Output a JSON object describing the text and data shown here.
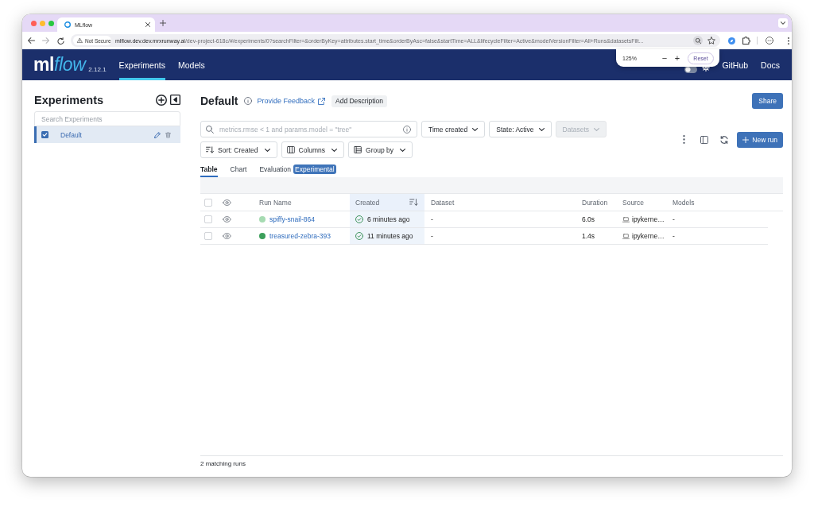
{
  "browser": {
    "tabs": [
      {
        "title": "MLflow",
        "selected": true
      }
    ],
    "security": "Not Secure",
    "url": "**mlflow.dev.dev.mrxrunway.ai**/dev-project-618c/#/experiments/0?searchFilter=&orderByKey=attributes.start_time&orderByAsc=false&startTime=ALL&lifecycleFilter=Active&modelVersionFilter=All+Runs&datasetsFilt..."
  },
  "zoom_popup": {
    "level": "125%",
    "zoom_out": "−",
    "zoom_in": "+",
    "reset": "Reset"
  },
  "header": {
    "logo": {
      "text": "ml",
      "accent": "flow"
    },
    "version": "2.12.1",
    "nav": [
      {
        "label": "Experiments",
        "selected": true
      },
      {
        "label": "Models",
        "selected": false
      }
    ],
    "links": [
      "GitHub",
      "Docs"
    ]
  },
  "sidebar": {
    "title": "Experiments",
    "search": {
      "placeholder": "Search Experiments"
    },
    "experiments": [
      {
        "name": "Default",
        "checked": true,
        "selected": true
      }
    ]
  },
  "main": {
    "title": "Default",
    "feedback_link": "Provide Feedback",
    "add_description": "Add Description",
    "share": "Share",
    "search": {
      "placeholder": "metrics.rmse < 1 and params.model = \"tree\""
    },
    "filters": [
      {
        "label": "Time created",
        "disabled": false
      },
      {
        "label": "State: Active",
        "disabled": false
      },
      {
        "label": "Datasets",
        "disabled": true
      }
    ],
    "new_run": "New run",
    "toolbar": [
      {
        "kind": "sort",
        "label": "Sort: Created"
      },
      {
        "kind": "columns",
        "label": "Columns"
      },
      {
        "kind": "group",
        "label": "Group by"
      }
    ],
    "view_tabs": [
      {
        "label": "Table",
        "selected": true
      },
      {
        "label": "Chart",
        "selected": false
      },
      {
        "label": "Evaluation",
        "selected": false,
        "badge": "Experimental"
      }
    ]
  },
  "table": {
    "select_all": {
      "checked": false
    },
    "columns": [
      {
        "label": "Run Name",
        "kind": "run",
        "sorted": false
      },
      {
        "label": "Created",
        "kind": "time",
        "sorted": true
      },
      {
        "label": "Dataset",
        "kind": "text",
        "sorted": false
      },
      {
        "label": "Duration",
        "kind": "text",
        "sorted": false
      },
      {
        "label": "Source",
        "kind": "source",
        "sorted": false
      },
      {
        "label": "Models",
        "kind": "text",
        "sorted": false
      }
    ],
    "rows": [
      {
        "selected": false,
        "color": "#a6dbb2",
        "cells": [
          "spiffy-snail-864",
          "6 minutes ago",
          "-",
          "6.0s",
          "ipykerne…",
          "-"
        ]
      },
      {
        "selected": false,
        "color": "#3c9f5b",
        "cells": [
          "treasured-zebra-393",
          "11 minutes ago",
          "-",
          "1.4s",
          "ipykerne…",
          "-"
        ]
      }
    ]
  },
  "footer": {
    "status": "2 matching runs"
  }
}
